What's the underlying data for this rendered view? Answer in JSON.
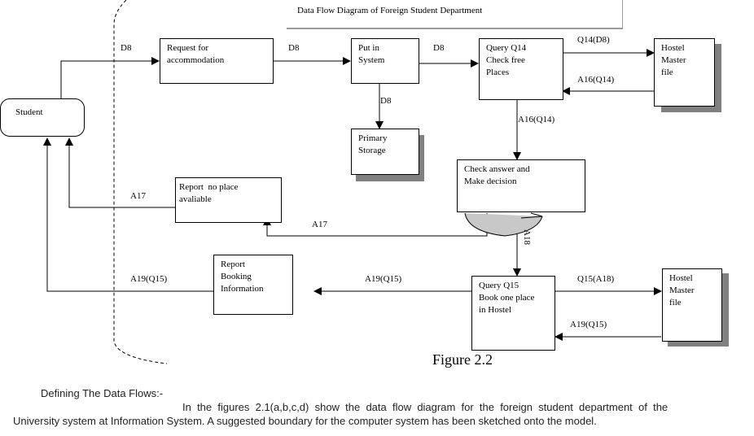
{
  "title": "Data Flow Diagram of Foreign Student Department",
  "figure_caption": "Figure 2.2",
  "nodes": {
    "student": "Student",
    "request": [
      "Request for",
      "accommodation"
    ],
    "put_in_system": [
      "Put in",
      "System"
    ],
    "primary_storage": [
      "Primary",
      "Storage"
    ],
    "query_q14": [
      "Query Q14",
      "Check free",
      "Places"
    ],
    "hostel_master_1": [
      "Hostel",
      "Master",
      "file"
    ],
    "check_answer": [
      "Check answer and",
      "Make decision"
    ],
    "report_no_place": [
      "Report  no place",
      "avaliable"
    ],
    "report_booking": [
      "Report",
      "Booking",
      "Information"
    ],
    "query_q15": [
      "Query Q15",
      "Book one place",
      "in Hostel"
    ],
    "hostel_master_2": [
      "Hostel",
      "Master",
      "file"
    ]
  },
  "flows": {
    "student_to_request": "D8",
    "request_to_put": "D8",
    "put_to_storage": "D8",
    "put_to_query14": "D8",
    "query14_to_hostel": "Q14(D8)",
    "hostel_to_query14": "A16(Q14)",
    "query14_to_check": "A16(Q14)",
    "check_to_report_no_place": "A17",
    "report_no_place_to_student": "A17",
    "check_to_query15": "A18",
    "query15_to_hostel": "Q15(A18)",
    "hostel_to_query15": "A19(Q15)",
    "query15_to_report_booking": "A19(Q15)",
    "report_booking_to_student": "A19(Q15)"
  },
  "text": {
    "heading": "Defining The Data Flows:-",
    "line1": "In  the  figures  2.1(a,b,c,d)  show  the  data  flow  diagram  for  the  foreign  student  department  of  the",
    "line2": "University system at Information System. A suggested boundary for the computer system has been sketched onto the model."
  }
}
